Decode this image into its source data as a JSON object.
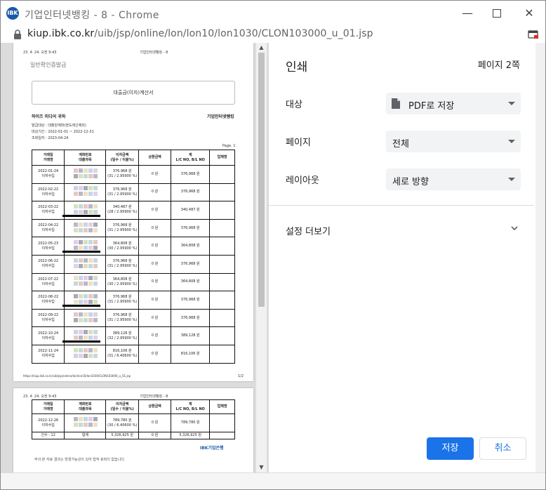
{
  "window": {
    "title": "기업인터넷뱅킹 - 8 - Chrome",
    "app_icon": "IBK"
  },
  "address": {
    "host": "kiup.ibk.co.kr",
    "path": "/uib/jsp/online/lon/lon10/lon1030/CLON103000_u_01.jsp"
  },
  "print": {
    "title": "인쇄",
    "page_count": "페이지 2쪽",
    "destination_label": "대상",
    "destination_value": "PDF로 저장",
    "pages_label": "페이지",
    "pages_value": "전체",
    "layout_label": "레이아웃",
    "layout_value": "세로 방향",
    "more_settings": "설정 더보기",
    "save": "저장",
    "cancel": "취소"
  },
  "doc": {
    "header_left": "23. 4. 24. 오전 9:43",
    "header_center": "기업인터넷뱅킹 - 8",
    "cert_label": "일반확인증발급",
    "box_title": "대출금(이자)계산서",
    "recipient": "하이즈 미디어 귀하",
    "bank": "기업인터넷뱅킹",
    "meta1": "발급대상 : 대출원계좌(현도래신제외)",
    "meta2": "대상기간 : 2022-01-01 ~ 2022-12-31",
    "meta3": "조회일자 : 2023-04-24",
    "page_label": "Page. 1",
    "col1": "거래일\n거래명",
    "col2": "계좌번호\n대출과목",
    "col3": "이자금액\n(일수 / 이율%)",
    "col4": "상환금액",
    "col5": "계\nL/C NO, B/L NO",
    "col6": "업체명",
    "rows": [
      {
        "date": "2022-01-24",
        "type": "이자수입",
        "interest": "376,968 원",
        "rate": "(31 / 2.95900 %)",
        "repay": "0 원",
        "total": "376,968 원"
      },
      {
        "date": "2022-02-22",
        "type": "이자수입",
        "interest": "376,968 원",
        "rate": "(31 / 2.95900 %)",
        "repay": "0 원",
        "total": "376,968 원"
      },
      {
        "date": "2022-03-22",
        "type": "이자수입",
        "interest": "340,487 원",
        "rate": "(28 / 2.95900 %)",
        "repay": "0 원",
        "total": "340,487 원"
      },
      {
        "date": "2022-04-22",
        "type": "이자수입",
        "interest": "376,968 원",
        "rate": "(31 / 2.95900 %)",
        "repay": "0 원",
        "total": "376,968 원"
      },
      {
        "date": "2022-05-23",
        "type": "이자수입",
        "interest": "364,808 원",
        "rate": "(30 / 2.95900 %)",
        "repay": "0 원",
        "total": "364,808 원"
      },
      {
        "date": "2022-06-22",
        "type": "이자수입",
        "interest": "376,968 원",
        "rate": "(31 / 2.95900 %)",
        "repay": "0 원",
        "total": "376,968 원"
      },
      {
        "date": "2022-07-22",
        "type": "이자수입",
        "interest": "364,808 원",
        "rate": "(30 / 2.95900 %)",
        "repay": "0 원",
        "total": "364,808 원"
      },
      {
        "date": "2022-08-22",
        "type": "이자수입",
        "interest": "376,968 원",
        "rate": "(31 / 2.95900 %)",
        "repay": "0 원",
        "total": "376,968 원"
      },
      {
        "date": "2022-09-22",
        "type": "이자수입",
        "interest": "376,968 원",
        "rate": "(31 / 2.95900 %)",
        "repay": "0 원",
        "total": "376,968 원"
      },
      {
        "date": "2022-10-24",
        "type": "이자수입",
        "interest": "389,128 원",
        "rate": "(32 / 2.95900 %)",
        "repay": "0 원",
        "total": "389,128 원"
      },
      {
        "date": "2022-11-24",
        "type": "이자수입",
        "interest": "816,106 원",
        "rate": "(31 / 6.40600 %)",
        "repay": "0 원",
        "total": "816,106 원"
      }
    ],
    "footer_url": "https://kiup.ibk.co.kr/uib/jsp/online/lon/lon10/lon1030/CLON103000_u_01.jsp",
    "footer_page": "1/2",
    "p2_row": {
      "date": "2022-12-26",
      "type": "이자수입",
      "interest": "789,780 원",
      "rate": "(30 / 6.40600 %)",
      "repay": "0 원",
      "total": "789,780 원"
    },
    "sum_count": "건수 : 12",
    "sum_label": "합계",
    "sum_interest": "5,326,925 원",
    "sum_repay": "0 원",
    "sum_total": "5,326,925 원",
    "ibk_logo": "IBK기업은행",
    "notice": "주의:본 자료 결과는 변경가능성이 있어 법적 효력이 없습니다."
  },
  "colors": {
    "accent": "#1a73e8",
    "select_bg": "#f1f3f4"
  }
}
